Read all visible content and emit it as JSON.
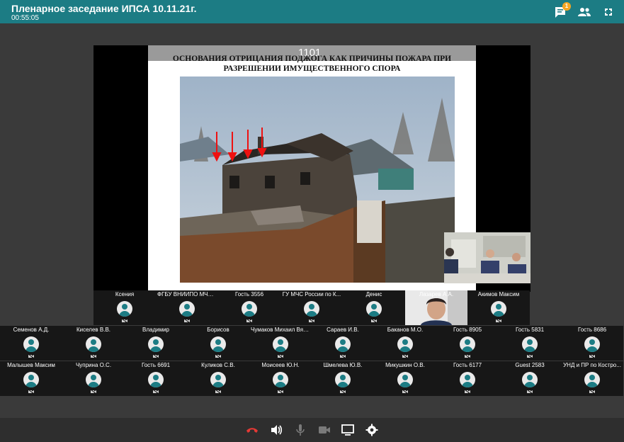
{
  "header": {
    "title": "Пленарное заседание ИПСА 10.11.21г.",
    "timer": "00:55:05",
    "chat_badge": "1",
    "icons": [
      "chat-icon",
      "participants-icon",
      "fullscreen-icon"
    ]
  },
  "stage": {
    "slide_number": "1101",
    "slide_title_line1": "ОСНОВАНИЯ ОТРИЦАНИЯ ПОДЖОГА КАК ПРИЧИНЫ ПОЖАРА ПРИ",
    "slide_title_line2": "РАЗРЕШЕНИИ ИМУЩЕСТВЕННОГО СПОРА"
  },
  "participants": {
    "row1": [
      "Ксения",
      "ФГБУ ВНИИПО МЧС ...",
      "Гость 3556",
      "ГУ МЧС России по К...",
      "Денис",
      "Лазарев А.А.",
      "Акимов Максим"
    ],
    "row2": [
      "Семенов А.Д.",
      "Киселев В.В.",
      "Владимир",
      "Борисов",
      "Чумаков Михаил Вяч...",
      "Сараев И.В.",
      "Баканов М.О.",
      "Гость 8905",
      "Гость 5831",
      "Гость 8686"
    ],
    "row3": [
      "Малышев Максим",
      "Чуприна О.С.",
      "Гость 6691",
      "Куликов С.В.",
      "Моисеев Ю.Н.",
      "Шмелева Ю.В.",
      "Микушкин О.В.",
      "Гость 6177",
      "Guest 2583",
      "УНД и ПР по Костро..."
    ]
  },
  "toolbar": {
    "icons": [
      "hangup-icon",
      "speaker-icon",
      "microphone-icon",
      "camera-icon",
      "screen-share-icon",
      "settings-icon"
    ]
  },
  "colors": {
    "accent": "#1c7c84",
    "background": "#3a3a3a",
    "hangup": "#e53935",
    "badge": "#f5a623"
  }
}
